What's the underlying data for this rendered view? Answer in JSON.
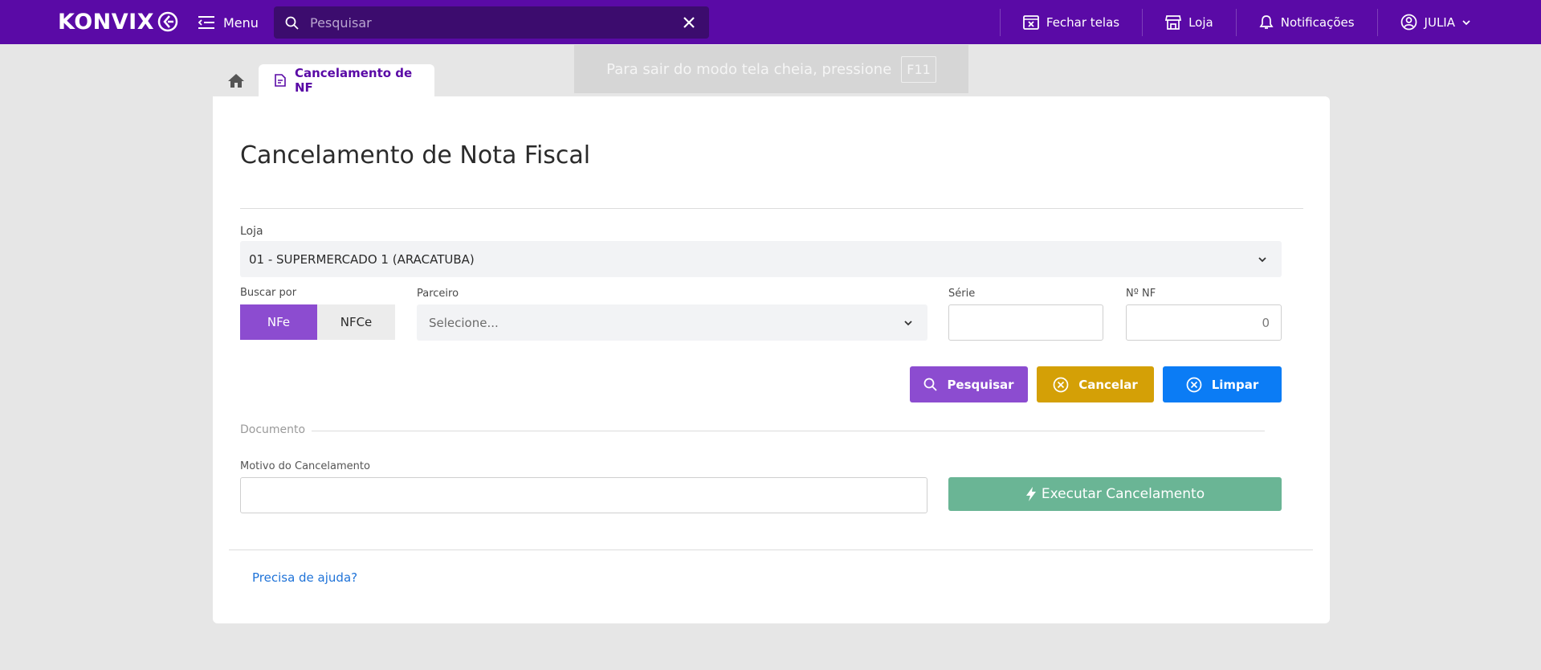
{
  "topbar": {
    "logo_text": "KONVIX",
    "menu_label": "Menu",
    "search_placeholder": "Pesquisar",
    "actions": {
      "close_screens": "Fechar telas",
      "store": "Loja",
      "notifications": "Notificações",
      "user": "JULIA"
    },
    "color": "#5a0aa6"
  },
  "toast": {
    "text": "Para sair do modo tela cheia, pressione",
    "key": "F11"
  },
  "tabs": {
    "active_label": "Cancelamento de NF"
  },
  "form": {
    "title": "Cancelamento de Nota Fiscal",
    "loja_label": "Loja",
    "loja_value": "01 - SUPERMERCADO 1 (ARACATUBA)",
    "buscar_label": "Buscar por",
    "toggle_nfe": "NFe",
    "toggle_nfce": "NFCe",
    "parceiro_label": "Parceiro",
    "parceiro_placeholder": "Selecione...",
    "serie_label": "Série",
    "serie_value": "",
    "nnf_label": "Nº NF",
    "nnf_value": "0",
    "btn_pesquisar": "Pesquisar",
    "btn_cancelar": "Cancelar",
    "btn_limpar": "Limpar",
    "documento_label": "Documento",
    "motivo_label": "Motivo do Cancelamento",
    "motivo_value": "",
    "btn_executar": "Executar Cancelamento",
    "help_link": "Precisa de ajuda?"
  },
  "colors": {
    "primary": "#8c4cd0",
    "warning": "#d4a006",
    "info": "#0b7cf5",
    "success_muted": "#6ab595",
    "link": "#1f73d8"
  }
}
